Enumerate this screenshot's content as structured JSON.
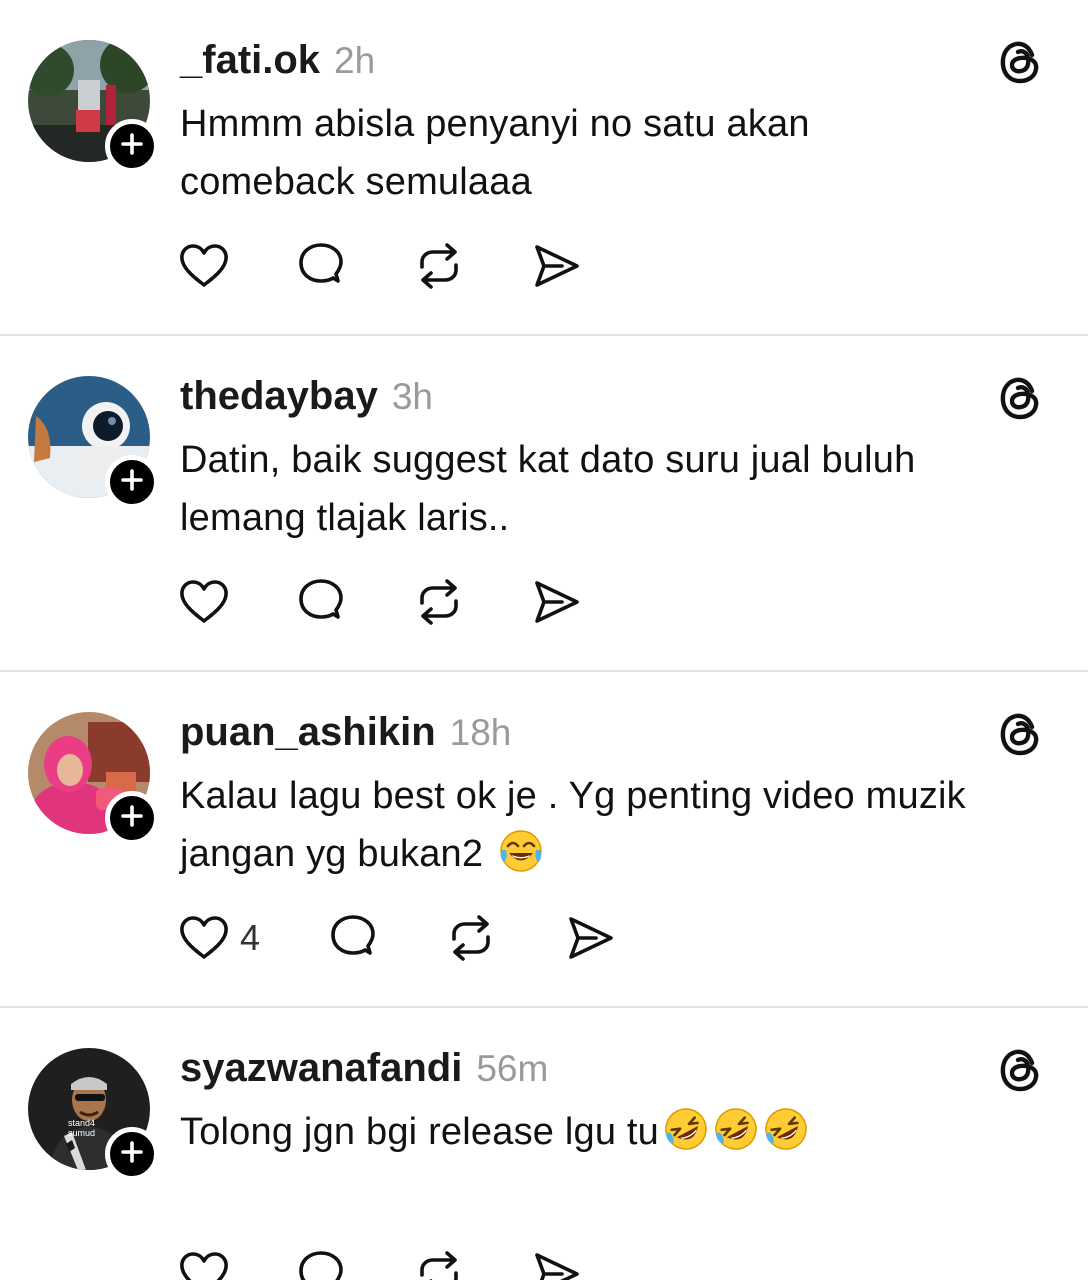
{
  "posts": [
    {
      "username": "_fati.ok",
      "time": "2h",
      "text_lines": [
        "Hmmm abisla penyanyi no satu akan",
        "comeback semulaaa"
      ],
      "emoji": "",
      "emoji_count": 0,
      "likes": "",
      "avatar": "street-photo"
    },
    {
      "username": "thedaybay",
      "time": "3h",
      "text_lines": [
        "Datin, baik suggest kat dato suru jual buluh",
        "lemang tlajak laris.."
      ],
      "emoji": "",
      "emoji_count": 0,
      "likes": "",
      "avatar": "astronaut"
    },
    {
      "username": "puan_ashikin",
      "time": "18h",
      "text_lines": [
        "Kalau lagu best ok je . Yg penting video muzik",
        "jangan yg bukan2"
      ],
      "emoji": "face-with-tears-of-joy",
      "emoji_count": 1,
      "likes": "4",
      "avatar": "woman-pink-hijab"
    },
    {
      "username": "syazwanafandi",
      "time": "56m",
      "text_lines": [
        "Tolong jgn bgi release lgu tu"
      ],
      "emoji": "rolling-on-the-floor-laughing",
      "emoji_count": 3,
      "likes": "",
      "avatar": "man-keffiyeh-stand4sumud"
    }
  ],
  "avatar_label_text": "stand4 sumud",
  "icons": {
    "follow": "plus-icon",
    "logo": "threads-logo-icon",
    "like": "heart-icon",
    "reply": "comment-bubble-icon",
    "repost": "repost-icon",
    "share": "send-icon"
  },
  "colors": {
    "text": "#111111",
    "muted": "#9a9a9a",
    "divider": "#e4e4e4"
  }
}
